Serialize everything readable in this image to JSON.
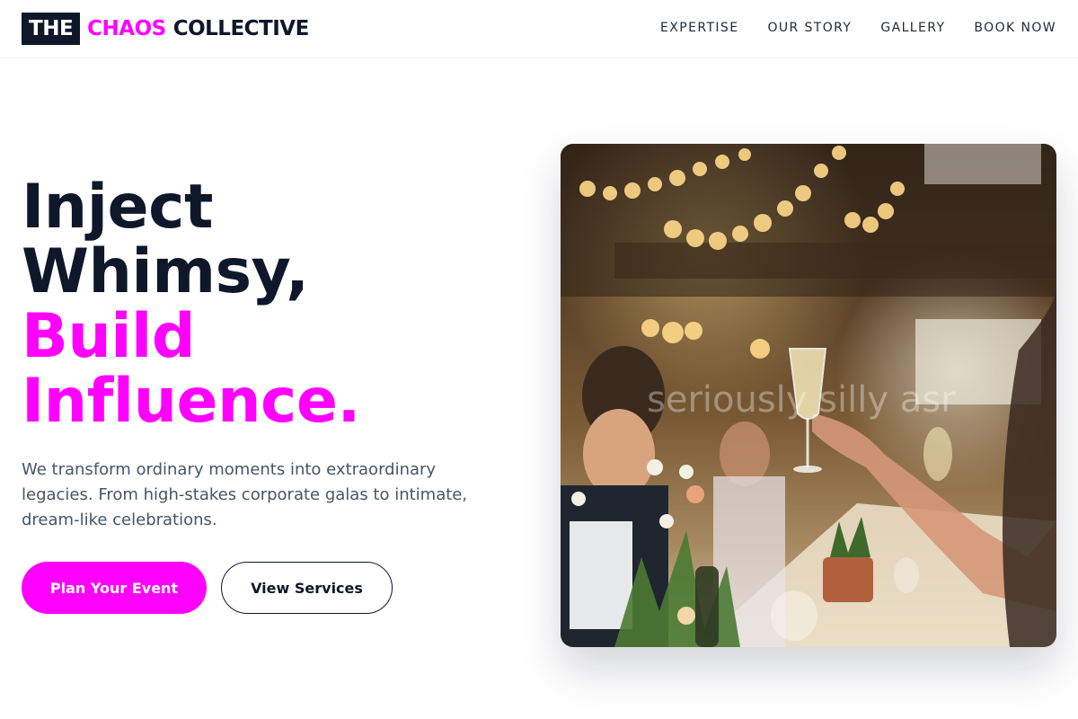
{
  "header": {
    "logo": {
      "box_text": "THE",
      "accent_text": "CHAOS",
      "rest_text": "COLLECTIVE"
    },
    "nav": [
      {
        "label": "EXPERTISE"
      },
      {
        "label": "OUR STORY"
      },
      {
        "label": "GALLERY"
      },
      {
        "label": "BOOK NOW"
      }
    ]
  },
  "hero": {
    "title_line1": "Inject",
    "title_line2": "Whimsy,",
    "title_line3": "Build",
    "title_line4": "Influence.",
    "description": "We transform ordinary moments into extraordinary legacies. From high-stakes corporate galas to intimate, dream-like celebrations.",
    "primary_button": "Plan Your Event",
    "secondary_button": "View Services",
    "image_watermark": "seriously silly asr"
  },
  "colors": {
    "accent": "#ff00ff",
    "dark": "#0f172a",
    "muted": "#475569"
  }
}
